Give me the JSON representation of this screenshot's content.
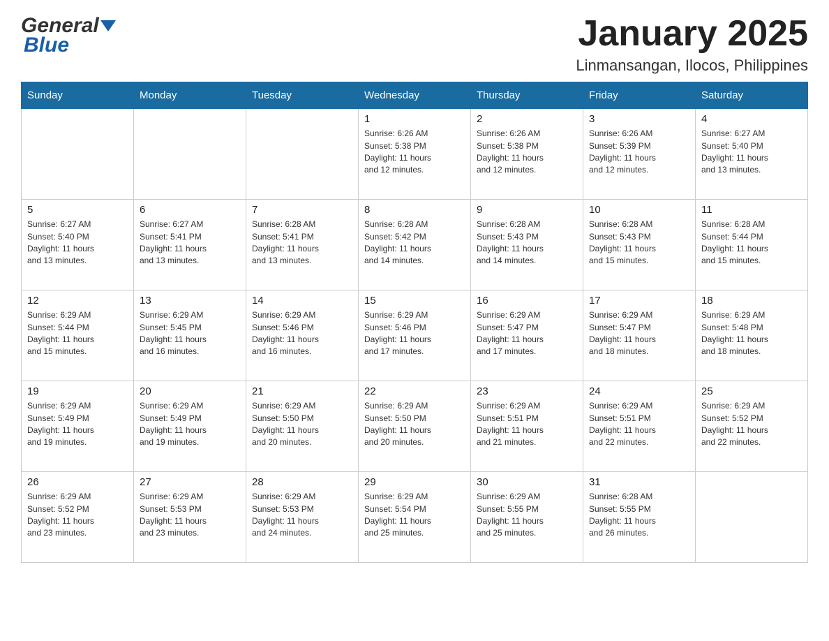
{
  "header": {
    "logo": {
      "general": "General",
      "blue": "Blue"
    },
    "title": "January 2025",
    "location": "Linmansangan, Ilocos, Philippines"
  },
  "calendar": {
    "days_of_week": [
      "Sunday",
      "Monday",
      "Tuesday",
      "Wednesday",
      "Thursday",
      "Friday",
      "Saturday"
    ],
    "weeks": [
      [
        {
          "day": "",
          "info": ""
        },
        {
          "day": "",
          "info": ""
        },
        {
          "day": "",
          "info": ""
        },
        {
          "day": "1",
          "info": "Sunrise: 6:26 AM\nSunset: 5:38 PM\nDaylight: 11 hours\nand 12 minutes."
        },
        {
          "day": "2",
          "info": "Sunrise: 6:26 AM\nSunset: 5:38 PM\nDaylight: 11 hours\nand 12 minutes."
        },
        {
          "day": "3",
          "info": "Sunrise: 6:26 AM\nSunset: 5:39 PM\nDaylight: 11 hours\nand 12 minutes."
        },
        {
          "day": "4",
          "info": "Sunrise: 6:27 AM\nSunset: 5:40 PM\nDaylight: 11 hours\nand 13 minutes."
        }
      ],
      [
        {
          "day": "5",
          "info": "Sunrise: 6:27 AM\nSunset: 5:40 PM\nDaylight: 11 hours\nand 13 minutes."
        },
        {
          "day": "6",
          "info": "Sunrise: 6:27 AM\nSunset: 5:41 PM\nDaylight: 11 hours\nand 13 minutes."
        },
        {
          "day": "7",
          "info": "Sunrise: 6:28 AM\nSunset: 5:41 PM\nDaylight: 11 hours\nand 13 minutes."
        },
        {
          "day": "8",
          "info": "Sunrise: 6:28 AM\nSunset: 5:42 PM\nDaylight: 11 hours\nand 14 minutes."
        },
        {
          "day": "9",
          "info": "Sunrise: 6:28 AM\nSunset: 5:43 PM\nDaylight: 11 hours\nand 14 minutes."
        },
        {
          "day": "10",
          "info": "Sunrise: 6:28 AM\nSunset: 5:43 PM\nDaylight: 11 hours\nand 15 minutes."
        },
        {
          "day": "11",
          "info": "Sunrise: 6:28 AM\nSunset: 5:44 PM\nDaylight: 11 hours\nand 15 minutes."
        }
      ],
      [
        {
          "day": "12",
          "info": "Sunrise: 6:29 AM\nSunset: 5:44 PM\nDaylight: 11 hours\nand 15 minutes."
        },
        {
          "day": "13",
          "info": "Sunrise: 6:29 AM\nSunset: 5:45 PM\nDaylight: 11 hours\nand 16 minutes."
        },
        {
          "day": "14",
          "info": "Sunrise: 6:29 AM\nSunset: 5:46 PM\nDaylight: 11 hours\nand 16 minutes."
        },
        {
          "day": "15",
          "info": "Sunrise: 6:29 AM\nSunset: 5:46 PM\nDaylight: 11 hours\nand 17 minutes."
        },
        {
          "day": "16",
          "info": "Sunrise: 6:29 AM\nSunset: 5:47 PM\nDaylight: 11 hours\nand 17 minutes."
        },
        {
          "day": "17",
          "info": "Sunrise: 6:29 AM\nSunset: 5:47 PM\nDaylight: 11 hours\nand 18 minutes."
        },
        {
          "day": "18",
          "info": "Sunrise: 6:29 AM\nSunset: 5:48 PM\nDaylight: 11 hours\nand 18 minutes."
        }
      ],
      [
        {
          "day": "19",
          "info": "Sunrise: 6:29 AM\nSunset: 5:49 PM\nDaylight: 11 hours\nand 19 minutes."
        },
        {
          "day": "20",
          "info": "Sunrise: 6:29 AM\nSunset: 5:49 PM\nDaylight: 11 hours\nand 19 minutes."
        },
        {
          "day": "21",
          "info": "Sunrise: 6:29 AM\nSunset: 5:50 PM\nDaylight: 11 hours\nand 20 minutes."
        },
        {
          "day": "22",
          "info": "Sunrise: 6:29 AM\nSunset: 5:50 PM\nDaylight: 11 hours\nand 20 minutes."
        },
        {
          "day": "23",
          "info": "Sunrise: 6:29 AM\nSunset: 5:51 PM\nDaylight: 11 hours\nand 21 minutes."
        },
        {
          "day": "24",
          "info": "Sunrise: 6:29 AM\nSunset: 5:51 PM\nDaylight: 11 hours\nand 22 minutes."
        },
        {
          "day": "25",
          "info": "Sunrise: 6:29 AM\nSunset: 5:52 PM\nDaylight: 11 hours\nand 22 minutes."
        }
      ],
      [
        {
          "day": "26",
          "info": "Sunrise: 6:29 AM\nSunset: 5:52 PM\nDaylight: 11 hours\nand 23 minutes."
        },
        {
          "day": "27",
          "info": "Sunrise: 6:29 AM\nSunset: 5:53 PM\nDaylight: 11 hours\nand 23 minutes."
        },
        {
          "day": "28",
          "info": "Sunrise: 6:29 AM\nSunset: 5:53 PM\nDaylight: 11 hours\nand 24 minutes."
        },
        {
          "day": "29",
          "info": "Sunrise: 6:29 AM\nSunset: 5:54 PM\nDaylight: 11 hours\nand 25 minutes."
        },
        {
          "day": "30",
          "info": "Sunrise: 6:29 AM\nSunset: 5:55 PM\nDaylight: 11 hours\nand 25 minutes."
        },
        {
          "day": "31",
          "info": "Sunrise: 6:28 AM\nSunset: 5:55 PM\nDaylight: 11 hours\nand 26 minutes."
        },
        {
          "day": "",
          "info": ""
        }
      ]
    ]
  }
}
